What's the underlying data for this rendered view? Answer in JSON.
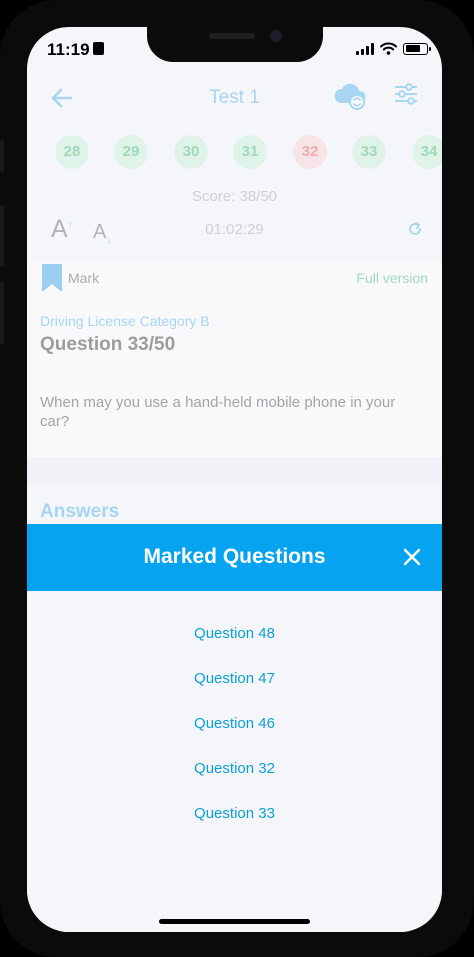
{
  "status_bar": {
    "time": "11:19"
  },
  "header": {
    "title": "Test 1"
  },
  "question_numbers": [
    {
      "label": "28",
      "state": "correct"
    },
    {
      "label": "29",
      "state": "correct"
    },
    {
      "label": "30",
      "state": "correct"
    },
    {
      "label": "31",
      "state": "correct"
    },
    {
      "label": "32",
      "state": "wrong"
    },
    {
      "label": "33",
      "state": "correct"
    },
    {
      "label": "34",
      "state": "correct"
    }
  ],
  "score": "Score: 38/50",
  "font_up_label": "A",
  "font_down_label": "A",
  "timer": "01:02:29",
  "card": {
    "mark_label": "Mark",
    "full_version_label": "Full version",
    "category": "Driving License Category B",
    "question_number": "Question 33/50",
    "question_text": "When may you use a hand-held mobile phone in your car?"
  },
  "answers_label": "Answers",
  "modal": {
    "title": "Marked Questions",
    "items": [
      "Question 48",
      "Question 47",
      "Question 46",
      "Question 32",
      "Question 33"
    ]
  },
  "colors": {
    "accent": "#06a3f0",
    "link": "#0d9fd6",
    "correct": "#2bb35d",
    "wrong": "#e04848"
  }
}
